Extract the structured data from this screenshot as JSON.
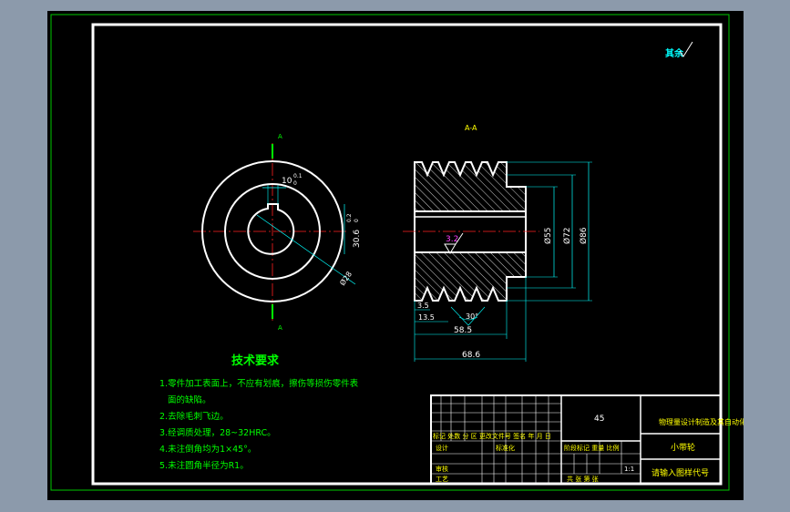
{
  "drawing": {
    "view_label": "A-A",
    "roughness_mark": "其余",
    "dims": {
      "keyway_width": "10",
      "keyway_tol_upper": "0.1",
      "keyway_tol_lower": "0",
      "keyway_depth": "30.6",
      "keyway_depth_tol_upper": "0.2",
      "keyway_depth_tol_lower": "0",
      "bore_dia": "Ø28",
      "d_bore_side": "Ø55",
      "d_root": "Ø72",
      "d_outer": "Ø86",
      "roughness": "3.2",
      "tooth_height": "3.5",
      "pitch": "13.5",
      "angle": "30°",
      "groove_span": "58.5",
      "total_width": "68.6"
    }
  },
  "tech": {
    "title": "技术要求",
    "lines": [
      "1.零件加工表面上，不应有划痕，擦伤等损伤零件表",
      "面的缺陷。",
      "2.去除毛刺飞边。",
      "3.经调质处理，28~32HRC。",
      "4.未注倒角均为1×45°。",
      "5.未注圆角半径为R1。"
    ]
  },
  "title_block": {
    "material": "45",
    "company": "物理量设计制造及其自动化",
    "part_name": "小带轮",
    "drawing_no": "请输入图样代号",
    "scale": "1:1",
    "rev_headers": "标记 处数 分 区 更改文件号 签名 年 月 日",
    "stage_headers": "阶段标记   重量  比例",
    "row_design": "设计",
    "row_std": "标准化",
    "row_review": "审核",
    "row_process": "工艺",
    "sheet_text": "共   张  第   张"
  }
}
